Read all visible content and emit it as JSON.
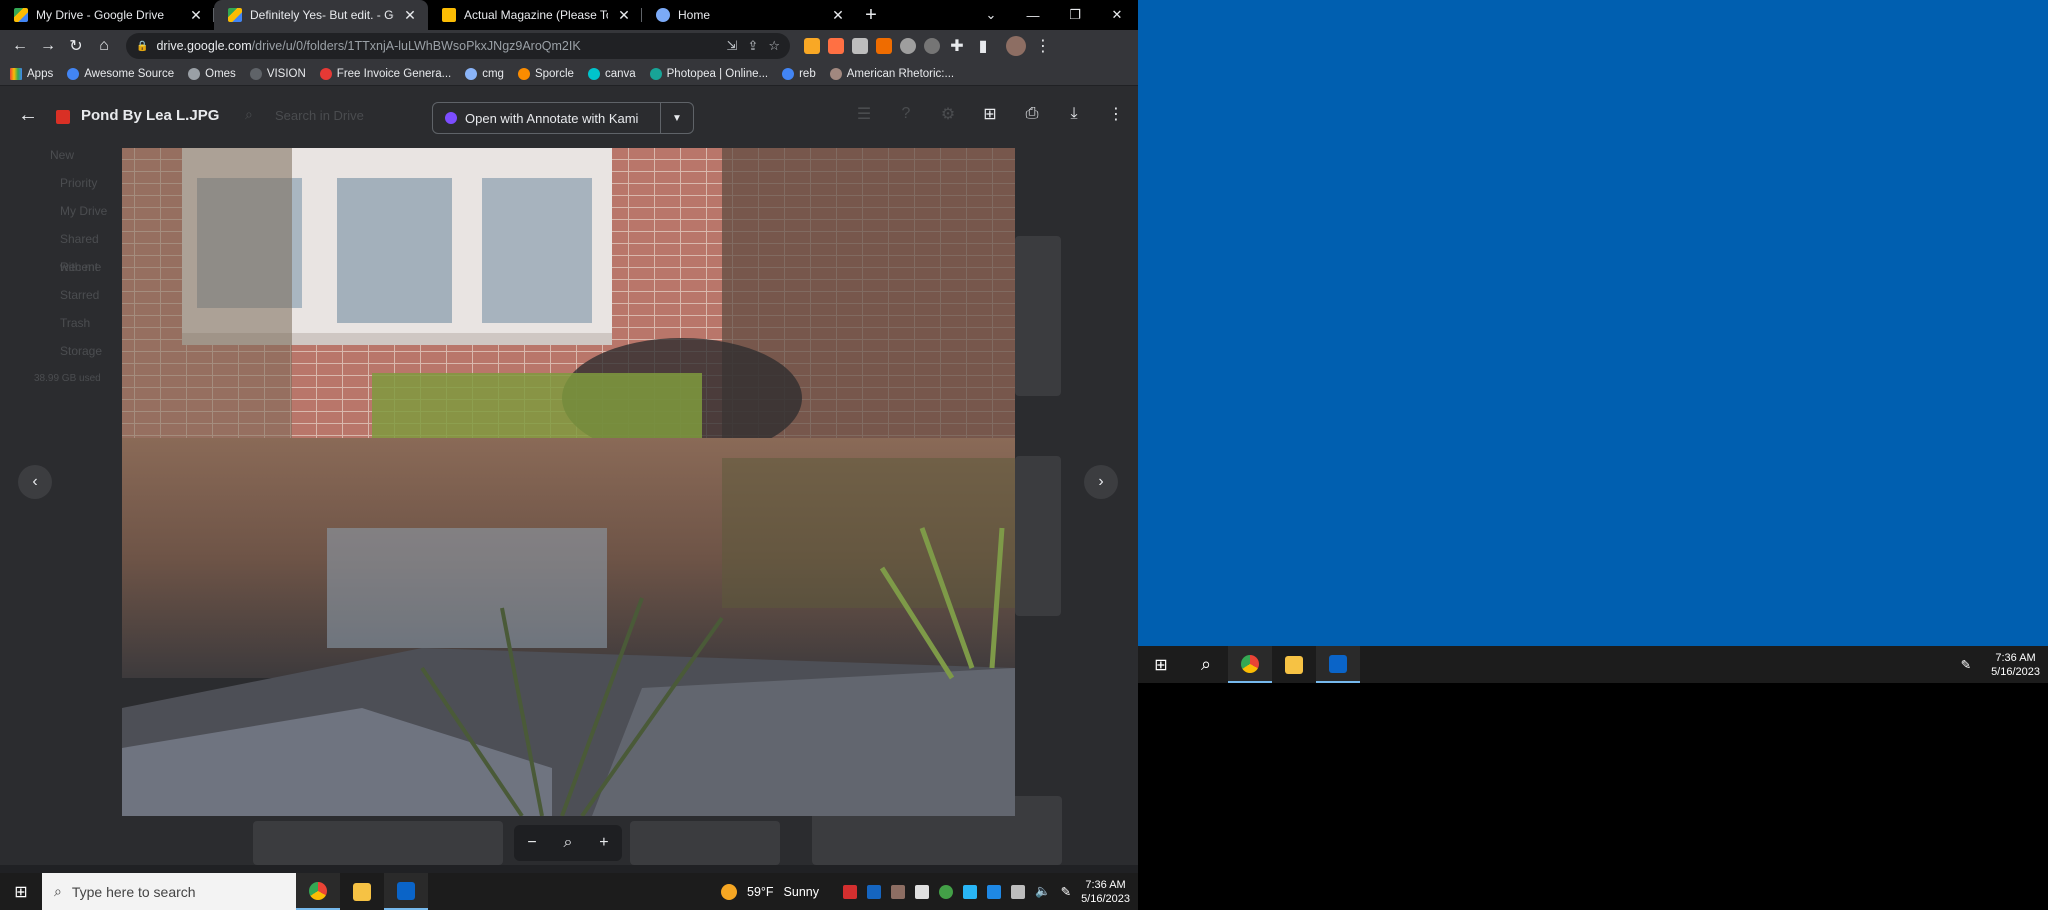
{
  "browser": {
    "tabs": [
      {
        "title": "My Drive - Google Drive",
        "favicon_color": "#fbbc04",
        "active": false
      },
      {
        "title": "Definitely Yes- But edit. - Google",
        "favicon_color": "#34a853",
        "active": true
      },
      {
        "title": "Actual Magazine (Please Touch) -",
        "favicon_color": "#fbbc04",
        "active": false
      },
      {
        "title": "Home",
        "favicon_color": "#7baaf7",
        "active": false
      }
    ],
    "url_host": "drive.google.com",
    "url_path": "/drive/u/0/folders/1TTxnjA-luLWhBWsoPkxJNgz9AroQm2IK",
    "bookmarks": [
      {
        "label": "Apps",
        "color": "#ea4335"
      },
      {
        "label": "Awesome Source",
        "color": "#4285f4"
      },
      {
        "label": "Omes",
        "color": "#9aa0a6"
      },
      {
        "label": "VISION",
        "color": "#5f6368"
      },
      {
        "label": "Free Invoice Genera...",
        "color": "#e53935"
      },
      {
        "label": "cmg",
        "color": "#8ab4f8"
      },
      {
        "label": "Sporcle",
        "color": "#fb8c00"
      },
      {
        "label": "canva",
        "color": "#00c4cc"
      },
      {
        "label": "Photopea | Online...",
        "color": "#18a497"
      },
      {
        "label": "reb",
        "color": "#4285f4"
      },
      {
        "label": "American Rhetoric:...",
        "color": "#a1887f"
      }
    ]
  },
  "viewer": {
    "file_name": "Pond By Lea L.JPG",
    "search_placeholder": "Search in Drive",
    "open_with_label": "Open with Annotate with Kami",
    "drive_sidebar": [
      "New",
      "Priority",
      "My Drive",
      "Shared with me",
      "Recent",
      "Starred",
      "Trash",
      "Storage",
      "38.99 GB used"
    ]
  },
  "taskbar_left": {
    "search_placeholder": "Type here to search",
    "weather_temp": "59°F",
    "weather_desc": "Sunny",
    "time": "7:36 AM",
    "date": "5/16/2023"
  },
  "taskbar_right": {
    "time": "7:36 AM",
    "date": "5/16/2023"
  },
  "colors": {
    "desktop_blue": "#005fb0",
    "chrome_dark": "#35363a",
    "taskbar": "#1c1c1c"
  }
}
